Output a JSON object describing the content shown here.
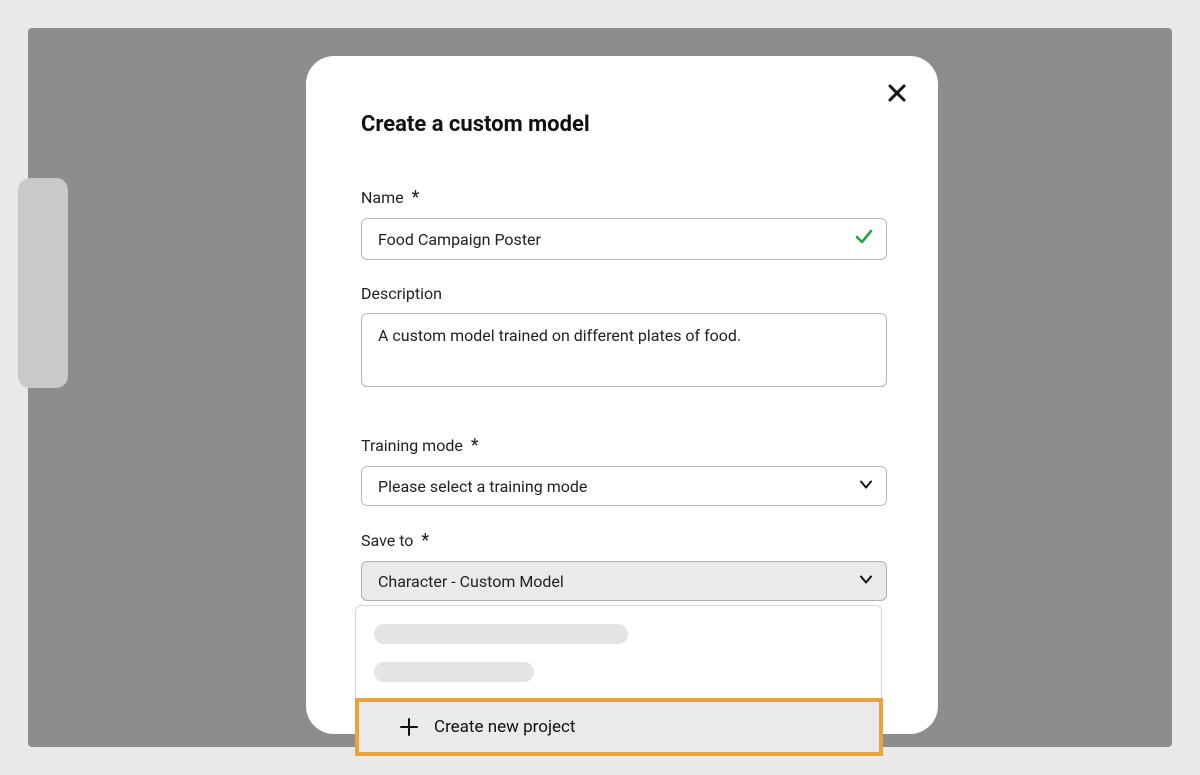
{
  "modal": {
    "title": "Create a custom model",
    "name": {
      "label": "Name",
      "value": "Food Campaign Poster"
    },
    "description": {
      "label": "Description",
      "value": "A custom model trained on different plates of food."
    },
    "training_mode": {
      "label": "Training mode",
      "value": "Please select a training mode"
    },
    "save_to": {
      "label": "Save to",
      "value": "Character - Custom Model"
    },
    "dropdown": {
      "create_new_project": "Create new project"
    }
  }
}
